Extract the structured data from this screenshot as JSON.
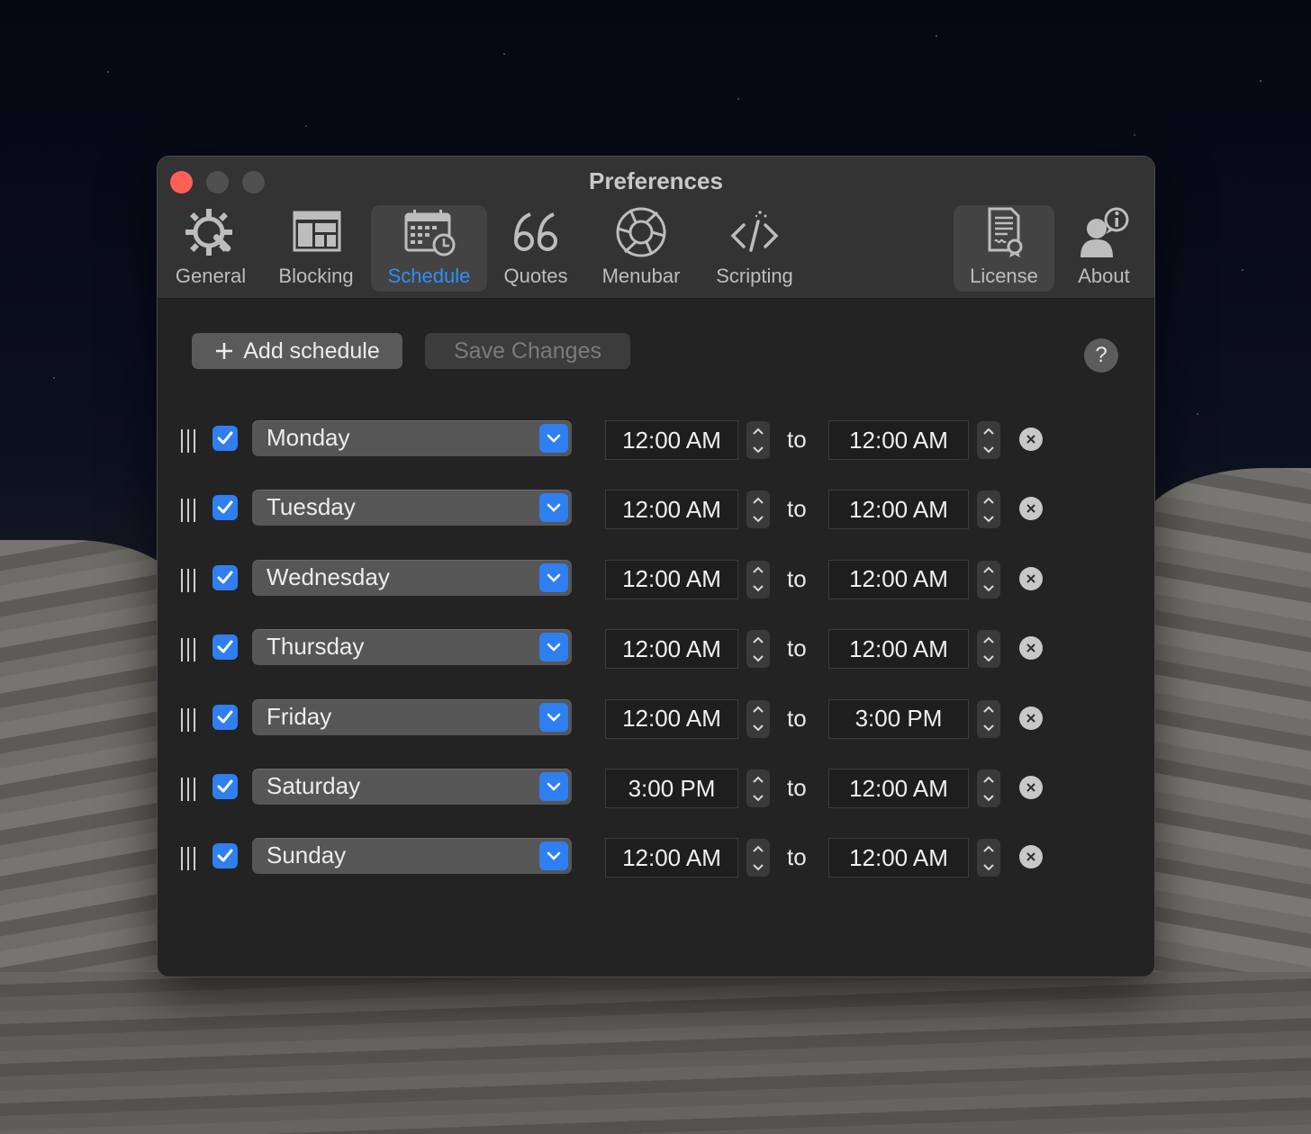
{
  "window": {
    "title": "Preferences"
  },
  "toolbar": {
    "items": [
      {
        "label": "General",
        "icon": "gear-wrench-icon"
      },
      {
        "label": "Blocking",
        "icon": "layout-block-icon"
      },
      {
        "label": "Schedule",
        "icon": "calendar-clock-icon",
        "active": true
      },
      {
        "label": "Quotes",
        "icon": "quote-marks-icon"
      },
      {
        "label": "Menubar",
        "icon": "aperture-icon"
      },
      {
        "label": "Scripting",
        "icon": "code-icon"
      },
      {
        "label": "License",
        "icon": "certificate-icon"
      },
      {
        "label": "About",
        "icon": "user-info-icon"
      }
    ],
    "active_color": "#2f8ff7"
  },
  "actions": {
    "add_label": "Add schedule",
    "save_label": "Save Changes",
    "help_label": "?"
  },
  "schedule": {
    "connector": "to",
    "rows": [
      {
        "day": "Monday",
        "enabled": true,
        "from": "12:00 AM",
        "to": "12:00 AM"
      },
      {
        "day": "Tuesday",
        "enabled": true,
        "from": "12:00 AM",
        "to": "12:00 AM"
      },
      {
        "day": "Wednesday",
        "enabled": true,
        "from": "12:00 AM",
        "to": "12:00 AM"
      },
      {
        "day": "Thursday",
        "enabled": true,
        "from": "12:00 AM",
        "to": "12:00 AM"
      },
      {
        "day": "Friday",
        "enabled": true,
        "from": "12:00 AM",
        "to": "3:00 PM"
      },
      {
        "day": "Saturday",
        "enabled": true,
        "from": "3:00 PM",
        "to": "12:00 AM"
      },
      {
        "day": "Sunday",
        "enabled": true,
        "from": "12:00 AM",
        "to": "12:00 AM"
      }
    ]
  },
  "colors": {
    "accent": "#2f7ff0",
    "close": "#fe5f57"
  }
}
